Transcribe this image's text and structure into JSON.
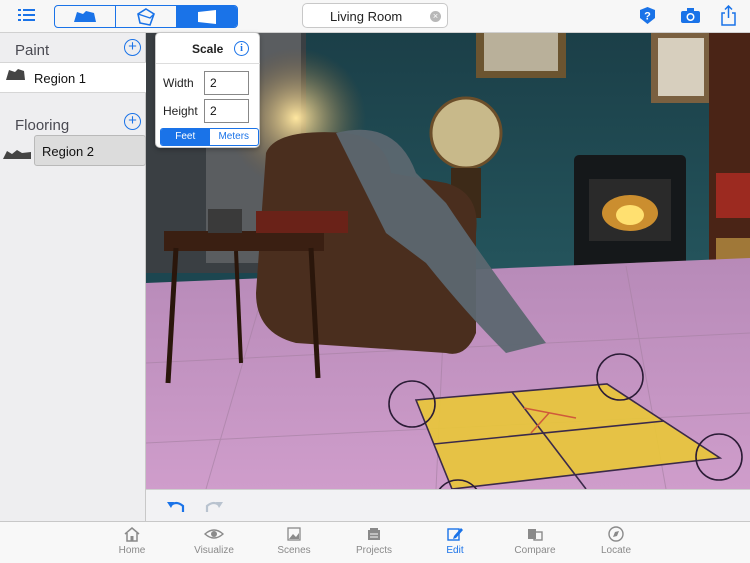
{
  "toolbar": {
    "title": "Living Room",
    "modes": [
      "paint-mode",
      "floor-mode",
      "wall-mode"
    ],
    "active_mode_index": 2
  },
  "panel": {
    "paint_title": "Paint",
    "paint_regions": [
      "Region 1"
    ],
    "flooring_title": "Flooring",
    "flooring_regions": [
      "Region 2"
    ]
  },
  "scale": {
    "title": "Scale",
    "width_label": "Width",
    "width_value": "2",
    "height_label": "Height",
    "height_value": "2",
    "unit_feet": "Feet",
    "unit_meters": "Meters",
    "selected_unit": "Feet"
  },
  "tabs": [
    {
      "label": "Home",
      "icon": "home-icon"
    },
    {
      "label": "Visualize",
      "icon": "eye-icon"
    },
    {
      "label": "Scenes",
      "icon": "image-icon"
    },
    {
      "label": "Projects",
      "icon": "folder-icon"
    },
    {
      "label": "Edit",
      "icon": "edit-icon"
    },
    {
      "label": "Compare",
      "icon": "compare-icon"
    },
    {
      "label": "Locate",
      "icon": "compass-icon"
    }
  ],
  "active_tab": "Edit",
  "colors": {
    "accent": "#1a73e8",
    "floor_overlay": "#c98ec4",
    "tile_overlay": "#e8c53a",
    "wall": "#1c4650"
  }
}
